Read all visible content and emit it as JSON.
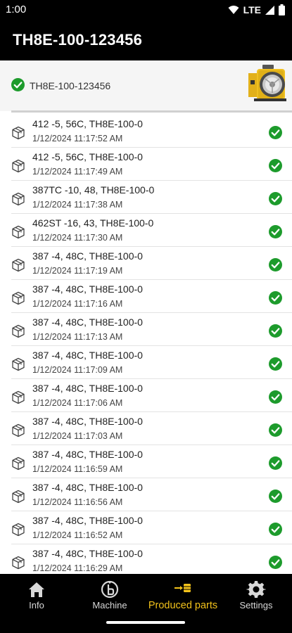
{
  "status_bar": {
    "time": "1:00",
    "network": "LTE"
  },
  "app_bar": {
    "title": "TH8E-100-123456"
  },
  "device": {
    "name": "TH8E-100-123456",
    "connected": true
  },
  "colors": {
    "accent": "#f2c21b",
    "success": "#1d9b2c",
    "background": "#ffffff",
    "bar": "#000000"
  },
  "parts": [
    {
      "title": "412 -5, 56C, TH8E-100-0",
      "time": "1/12/2024 11:17:52 AM"
    },
    {
      "title": "412 -5, 56C, TH8E-100-0",
      "time": "1/12/2024 11:17:49 AM"
    },
    {
      "title": "387TC -10, 48, TH8E-100-0",
      "time": "1/12/2024 11:17:38 AM"
    },
    {
      "title": "462ST -16, 43, TH8E-100-0",
      "time": "1/12/2024 11:17:30 AM"
    },
    {
      "title": "387 -4, 48C, TH8E-100-0",
      "time": "1/12/2024 11:17:19 AM"
    },
    {
      "title": "387 -4, 48C, TH8E-100-0",
      "time": "1/12/2024 11:17:16 AM"
    },
    {
      "title": "387 -4, 48C, TH8E-100-0",
      "time": "1/12/2024 11:17:13 AM"
    },
    {
      "title": "387 -4, 48C, TH8E-100-0",
      "time": "1/12/2024 11:17:09 AM"
    },
    {
      "title": "387 -4, 48C, TH8E-100-0",
      "time": "1/12/2024 11:17:06 AM"
    },
    {
      "title": "387 -4, 48C, TH8E-100-0",
      "time": "1/12/2024 11:17:03 AM"
    },
    {
      "title": "387 -4, 48C, TH8E-100-0",
      "time": "1/12/2024 11:16:59 AM"
    },
    {
      "title": "387 -4, 48C, TH8E-100-0",
      "time": "1/12/2024 11:16:56 AM"
    },
    {
      "title": "387 -4, 48C, TH8E-100-0",
      "time": "1/12/2024 11:16:52 AM"
    },
    {
      "title": "387 -4, 48C, TH8E-100-0",
      "time": "1/12/2024 11:16:29 AM"
    }
  ],
  "nav": {
    "info": "Info",
    "machine": "Machine",
    "produced_parts": "Produced parts",
    "settings": "Settings",
    "active": "produced_parts"
  }
}
